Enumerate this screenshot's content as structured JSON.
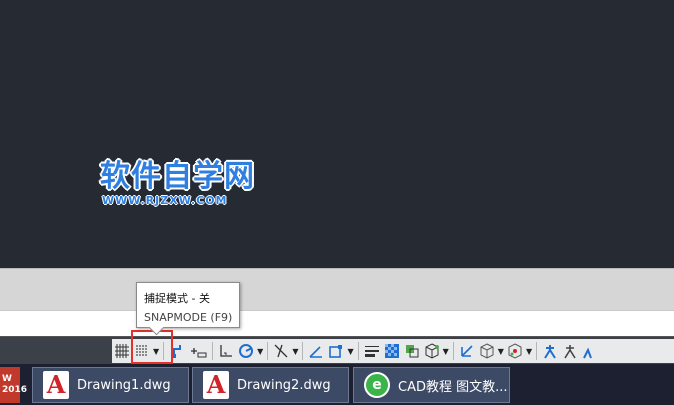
{
  "watermark": {
    "main": "软件自学网",
    "sub": "WWW.RJZXW.COM"
  },
  "tooltip": {
    "title": "捕捉模式 - 关",
    "command": "SNAPMODE (F9)"
  },
  "taskbar": {
    "start_label": "W\n2016",
    "tasks": [
      {
        "label": "Drawing1.dwg",
        "icon": "autocad-icon"
      },
      {
        "label": "Drawing2.dwg",
        "icon": "autocad-icon"
      },
      {
        "label": "CAD教程 图文教...",
        "icon": "browser-icon"
      }
    ]
  },
  "colors": {
    "canvas_bg": "#252a33",
    "highlight": "#e4322b",
    "watermark_blue": "#2f7fe0",
    "taskbar_bg": "#1c2030"
  }
}
